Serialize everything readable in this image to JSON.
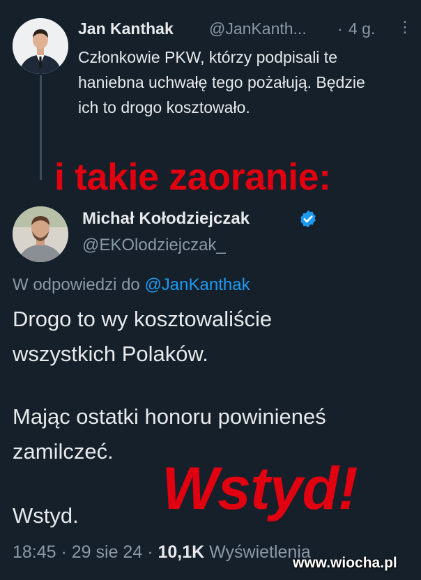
{
  "tweet1": {
    "author_name": "Jan Kanthak",
    "handle": "@JanKanth...",
    "dot": "·",
    "time": "4 g.",
    "more_icon": "more-dots-vertical-icon",
    "text": "Członkowie PKW, którzy podpisali te haniebna uchwałę tego pożałują. Będzie ich to drogo kosztowało."
  },
  "caption": "i takie zaoranie:",
  "tweet2": {
    "author_name": "Michał Kołodziejczak",
    "verified_icon": "verified-badge-icon",
    "handle": "@EKOlodziejczak_",
    "reply_prefix": "W odpowiedzi do",
    "reply_mention": "@JanKanthak",
    "lines": [
      "Drogo to wy kosztowaliście",
      "wszystkich Polaków.",
      "Mając ostatki honoru powinieneś",
      "zamilczeć.",
      "Wstyd."
    ],
    "footer_time": "18:45 · 29 sie 24 · ",
    "footer_views": "10,1K",
    "footer_views_label": " Wyświetlenia"
  },
  "stamp": "Wstyd!",
  "watermark": "www.wiocha.pl",
  "colors": {
    "background": "#15202b",
    "text": "#e7e9ea",
    "muted": "#8b98a5",
    "link": "#1d9bf0",
    "overlay_red": "#e00010"
  }
}
